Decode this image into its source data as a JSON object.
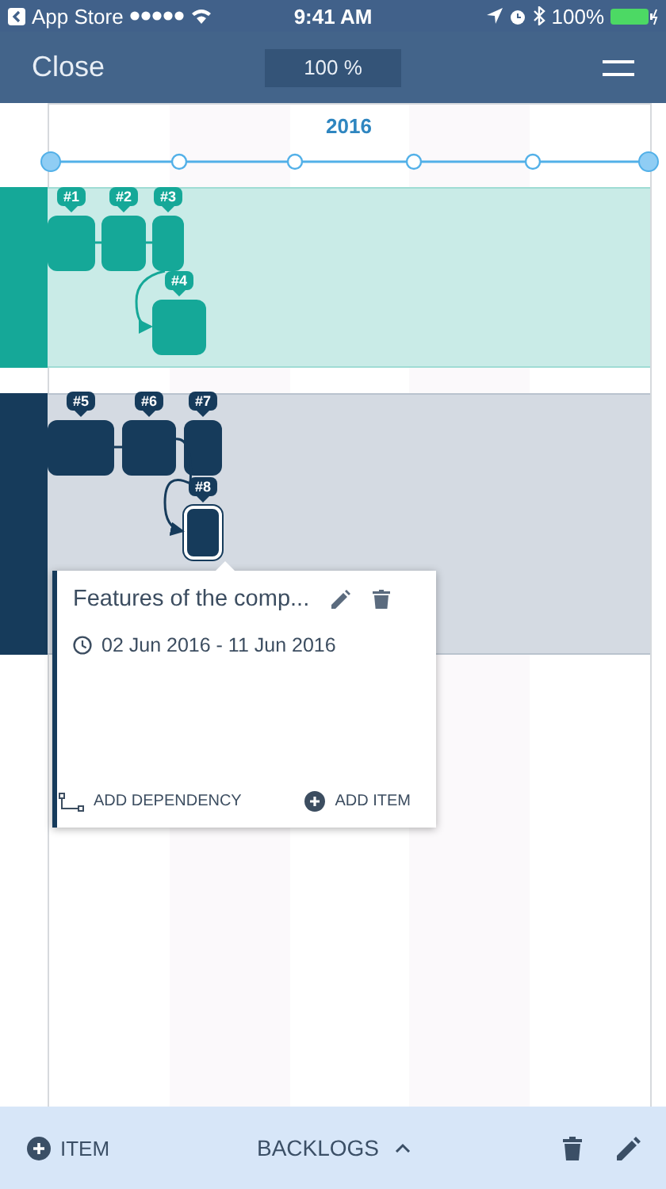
{
  "status_bar": {
    "back_label": "App Store",
    "time": "9:41 AM",
    "battery": "100%"
  },
  "nav": {
    "close": "Close",
    "zoom": "100 %"
  },
  "timeline": {
    "year": "2016"
  },
  "lanes": [
    {
      "color": "#15a898",
      "items": [
        {
          "label": "#1",
          "selected": false
        },
        {
          "label": "#2",
          "selected": false
        },
        {
          "label": "#3",
          "selected": false
        },
        {
          "label": "#4",
          "selected": false
        }
      ]
    },
    {
      "color": "#163b5b",
      "items": [
        {
          "label": "#5",
          "selected": false
        },
        {
          "label": "#6",
          "selected": false
        },
        {
          "label": "#7",
          "selected": false
        },
        {
          "label": "#8",
          "selected": true
        }
      ]
    }
  ],
  "popup": {
    "title": "Features of the comp...",
    "dates": "02 Jun 2016 - 11 Jun 2016",
    "add_dependency": "ADD DEPENDENCY",
    "add_item": "ADD ITEM"
  },
  "bottom_bar": {
    "item": "ITEM",
    "backlogs": "BACKLOGS"
  }
}
